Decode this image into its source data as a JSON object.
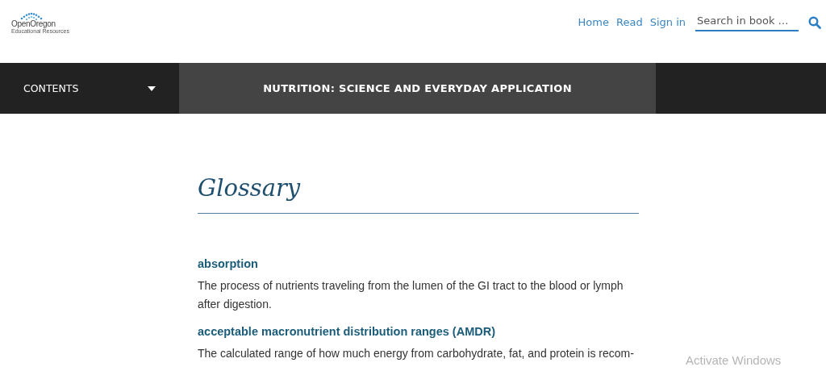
{
  "logo": {
    "name": "OpenOregon",
    "subtitle": "Educational Resources"
  },
  "nav": {
    "links": [
      "Home",
      "Read",
      "Sign in"
    ],
    "search": {
      "placeholder": "Search in book …"
    }
  },
  "bar": {
    "contents": "CONTENTS",
    "book_title": "NUTRITION: SCIENCE AND EVERYDAY APPLICATION"
  },
  "page": {
    "title": "Glossary",
    "entries": [
      {
        "term": "absorption",
        "definition": "The process of nutrients traveling from the lumen of the GI tract to the blood or lymph after digestion."
      },
      {
        "term": "acceptable macronutrient distribution ranges (AMDR)",
        "definition": "The calculated range of how much energy from carbohydrate, fat, and protein is recom-"
      }
    ]
  },
  "overlay": "Activate Windows"
}
